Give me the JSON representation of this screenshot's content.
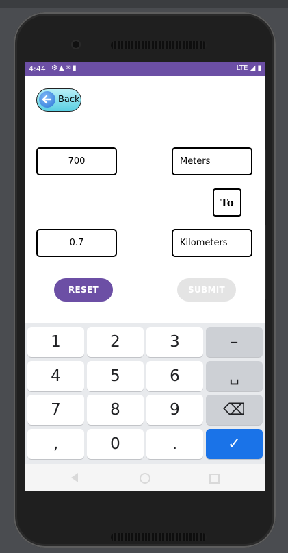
{
  "status_bar": {
    "time": "4:44",
    "network": "LTE"
  },
  "back_button": {
    "label": "Back"
  },
  "input": {
    "value": "700",
    "unit": "Meters"
  },
  "connector": "To",
  "output": {
    "value": "0.7",
    "unit": "Kilometers"
  },
  "actions": {
    "reset_label": "RESET",
    "submit_label": "SUBMIT"
  },
  "keyboard": {
    "keys": [
      "1",
      "2",
      "3",
      "–",
      "4",
      "5",
      "6",
      "␣",
      "7",
      "8",
      "9",
      "⌫",
      ",",
      "0",
      ".",
      "✓"
    ]
  },
  "colors": {
    "accent": "#6c4fa5",
    "keyboard_action": "#1a73e8"
  }
}
